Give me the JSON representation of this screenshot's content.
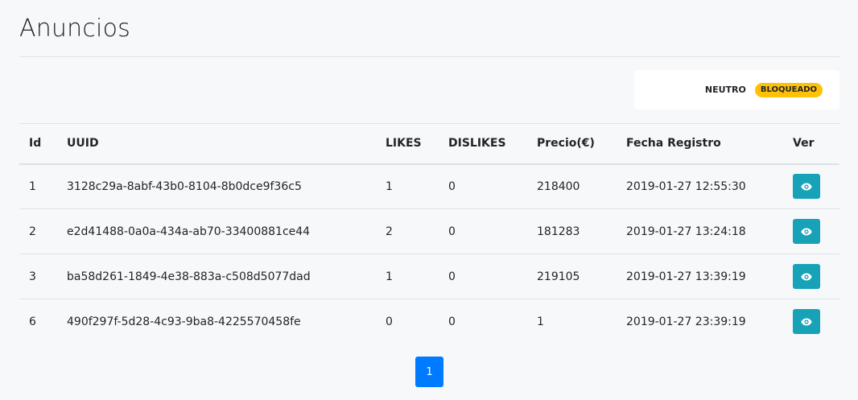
{
  "page": {
    "title": "Anuncios"
  },
  "legend": {
    "label": "NEUTRO",
    "badge": "BLOQUEADO",
    "badge_color": "#ffc107"
  },
  "table": {
    "headers": {
      "id": "Id",
      "uuid": "UUID",
      "likes": "LIKES",
      "dislikes": "DISLIKES",
      "precio": "Precio(€)",
      "fecha": "Fecha Registro",
      "ver": "Ver"
    },
    "rows": [
      {
        "id": "1",
        "uuid": "3128c29a-8abf-43b0-8104-8b0dce9f36c5",
        "likes": "1",
        "dislikes": "0",
        "precio": "218400",
        "fecha": "2019-01-27 12:55:30",
        "ver_icon": "eye-icon"
      },
      {
        "id": "2",
        "uuid": "e2d41488-0a0a-434a-ab70-33400881ce44",
        "likes": "2",
        "dislikes": "0",
        "precio": "181283",
        "fecha": "2019-01-27 13:24:18",
        "ver_icon": "eye-icon"
      },
      {
        "id": "3",
        "uuid": "ba58d261-1849-4e38-883a-c508d5077dad",
        "likes": "1",
        "dislikes": "0",
        "precio": "219105",
        "fecha": "2019-01-27 13:39:19",
        "ver_icon": "eye-icon"
      },
      {
        "id": "6",
        "uuid": "490f297f-5d28-4c93-9ba8-4225570458fe",
        "likes": "0",
        "dislikes": "0",
        "precio": "1",
        "fecha": "2019-01-27 23:39:19",
        "ver_icon": "eye-icon"
      }
    ]
  },
  "pagination": {
    "current": "1",
    "active_color": "#007bff"
  },
  "colors": {
    "view_button": "#17a2b8"
  }
}
